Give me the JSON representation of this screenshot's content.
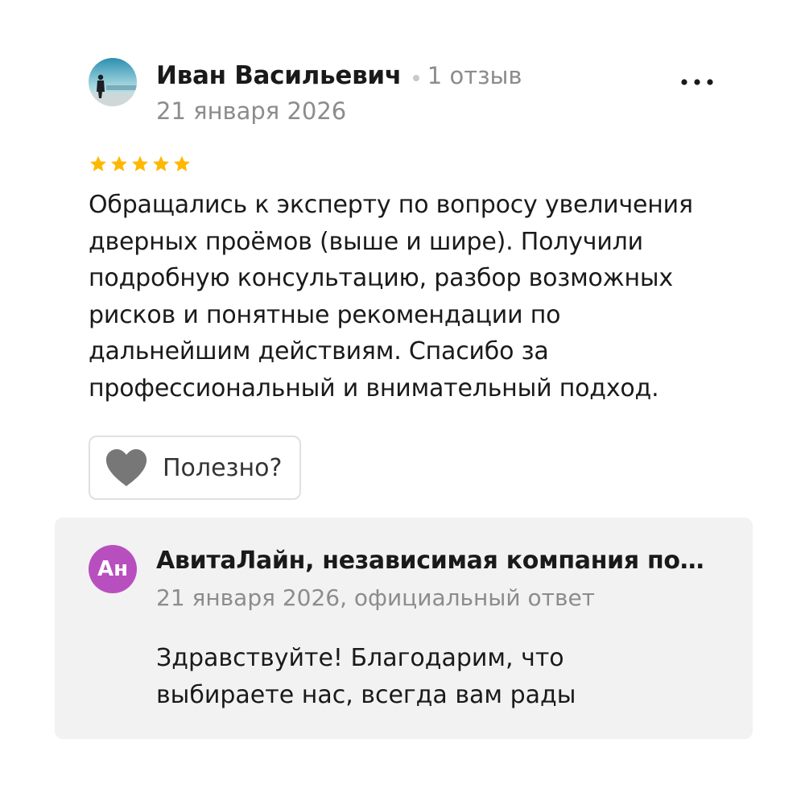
{
  "review": {
    "author": {
      "name": "Иван Васильевич",
      "reviews_count": "1 отзыв",
      "avatar_icon": "user-photo-avatar"
    },
    "date": "21 января 2026",
    "rating": 5,
    "max_rating": 5,
    "star_color": "#ffb800",
    "text": "Обращались к эксперту по вопросу увеличения дверных проёмов (выше и шире). Получили подробную консультацию, разбор возможных рисков и понятные рекомендации по дальнейшим действиям. Спасибо за профессиональный и внимательный подход.",
    "more_icon": "more-horizontal-icon",
    "useful_button": {
      "label": "Полезно?",
      "icon": "heart-icon"
    }
  },
  "reply": {
    "avatar_initials": "Ан",
    "avatar_color": "#b84fbf",
    "author": "АвитаЛайн, независимая компания по…",
    "meta": "21 января 2026, официальный ответ",
    "text": "Здравствуйте! Благодарим, что выбираете нас, всегда вам рады"
  }
}
